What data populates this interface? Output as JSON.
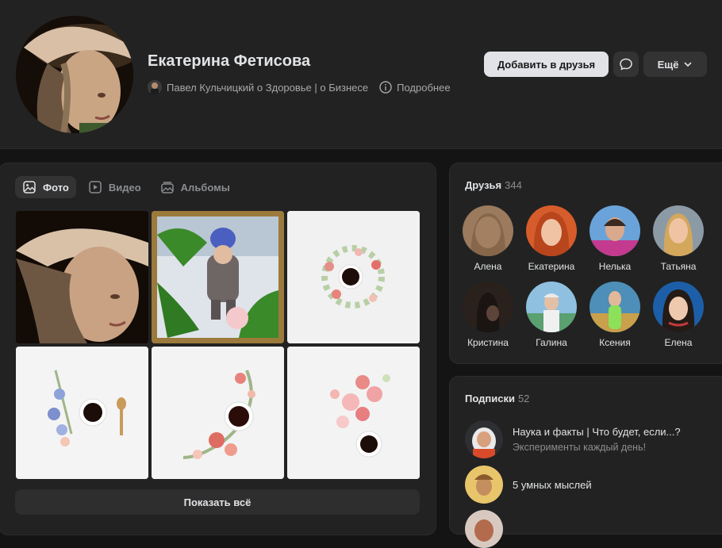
{
  "profile": {
    "name": "Екатерина Фетисова",
    "status_text": "Павел Кульчицкий о Здоровье | о Бизнесе",
    "details_link": "Подробнее",
    "add_friend_label": "Добавить в друзья",
    "more_label": "Ещё"
  },
  "media": {
    "tabs": [
      {
        "label": "Фото",
        "icon": "image-icon",
        "active": true
      },
      {
        "label": "Видео",
        "icon": "video-icon",
        "active": false
      },
      {
        "label": "Альбомы",
        "icon": "albums-icon",
        "active": false
      }
    ],
    "show_all_label": "Показать всё"
  },
  "friends": {
    "title": "Друзья",
    "count": "344",
    "items": [
      {
        "name": "Алена"
      },
      {
        "name": "Екатерина"
      },
      {
        "name": "Нелька"
      },
      {
        "name": "Татьяна"
      },
      {
        "name": "Кристина"
      },
      {
        "name": "Галина"
      },
      {
        "name": "Ксения"
      },
      {
        "name": "Елена"
      }
    ]
  },
  "subscriptions": {
    "title": "Подписки",
    "count": "52",
    "items": [
      {
        "title": "Наука и факты | Что будет, если...?",
        "subtitle": "Эксперименты каждый день!"
      },
      {
        "title": "5 умных мыслей",
        "subtitle": ""
      }
    ]
  }
}
